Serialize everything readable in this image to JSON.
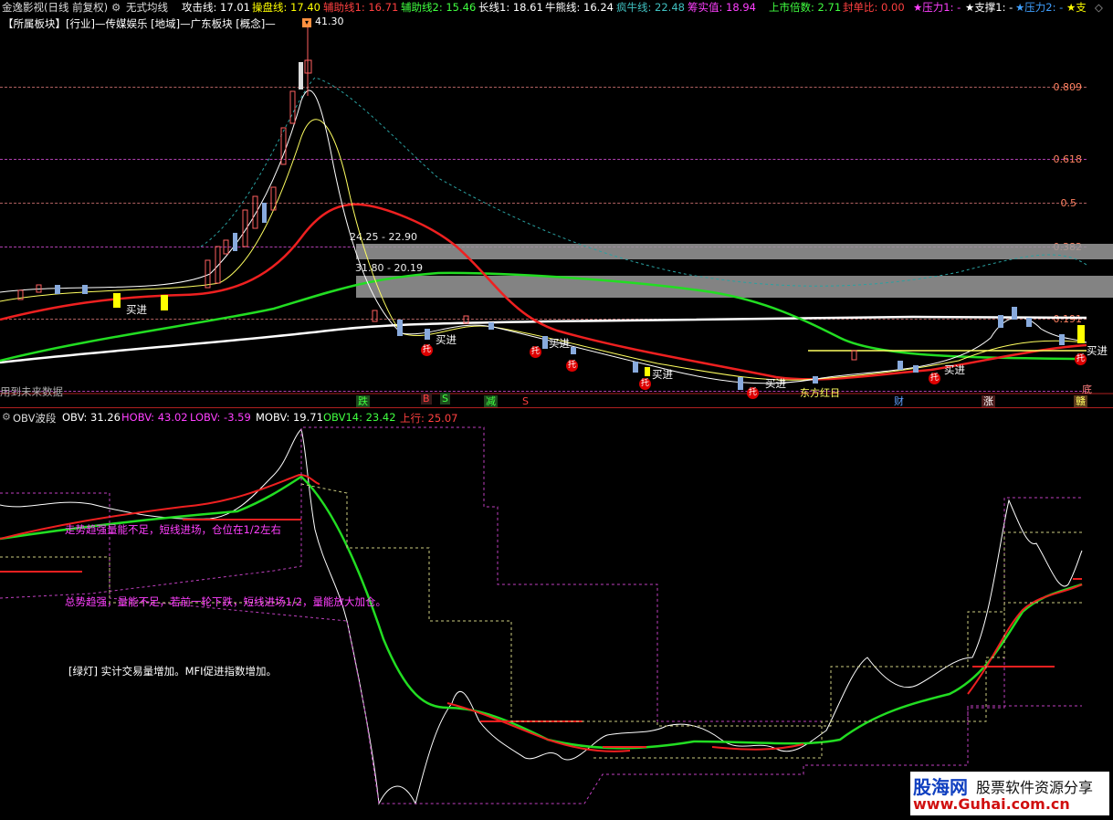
{
  "app": {
    "title": "金逸影视(日线 前复权)",
    "indicator_name": "无式均线"
  },
  "topbar": [
    {
      "text": "攻击线: 17.01",
      "color": "#ffffff"
    },
    {
      "text": "操盘线: 17.40",
      "color": "#ffff00"
    },
    {
      "text": "辅助线1: 16.71",
      "color": "#ff4040"
    },
    {
      "text": "辅助线2: 15.46",
      "color": "#40ff40"
    },
    {
      "text": "长线1: 18.61",
      "color": "#ffffff"
    },
    {
      "text": "牛熊线: 16.24",
      "color": "#ffffff"
    },
    {
      "text": "疯牛线: 22.48",
      "color": "#40c0c0"
    },
    {
      "text": "筹实值: 18.94",
      "color": "#ff40ff"
    },
    {
      "text": "上市倍数: 2.71",
      "color": "#40ff40"
    },
    {
      "text": "封单比: 0.00",
      "color": "#ff4040"
    },
    {
      "text": "★压力1: -",
      "color": "#ff40ff"
    },
    {
      "text": "★支撑1: -",
      "color": "#ffffff"
    },
    {
      "text": "★压力2: -",
      "color": "#40a0ff"
    },
    {
      "text": "★支",
      "color": "#ffff00"
    }
  ],
  "sector_line": "【所属板块】[行业]—传媒娱乐 [地域]—广东板块 [概念]—",
  "peak_price": "41.30",
  "fib_levels": [
    "0.809",
    "0.618",
    "0.5",
    "0.382",
    "0.191"
  ],
  "range_labels": [
    "24.25 - 22.90",
    "31.80 - 20.19"
  ],
  "future_text": "用到未来数据",
  "bottom_signals": [
    {
      "text": "跌",
      "color": "#40ff40",
      "bg": "#205020"
    },
    {
      "text": "B",
      "color": "#ff4040",
      "bg": "#402020"
    },
    {
      "text": "S",
      "color": "#40ff40",
      "bg": "#205020"
    },
    {
      "text": "减",
      "color": "#40ff40",
      "bg": "#205020"
    },
    {
      "text": "S",
      "color": "#ff4040",
      "bg": ""
    },
    {
      "text": "东方红日",
      "color": "#ffff60",
      "bg": ""
    },
    {
      "text": "财",
      "color": "#60a0ff",
      "bg": ""
    },
    {
      "text": "涨",
      "color": "#ffffff",
      "bg": "#502020"
    },
    {
      "text": "赣",
      "color": "#ffff60",
      "bg": "#604020"
    },
    {
      "text": "底",
      "color": "#ff8080",
      "bg": ""
    }
  ],
  "buy_label": "买进",
  "tuo_label": "托",
  "lower_panel": {
    "title": "OBV波段",
    "values": [
      {
        "text": "OBV: 31.26",
        "color": "#ffffff"
      },
      {
        "text": "HOBV: 43.02",
        "color": "#ff40ff"
      },
      {
        "text": "LOBV: -3.59",
        "color": "#ff40ff"
      },
      {
        "text": "MOBV: 19.71",
        "color": "#ffffff"
      },
      {
        "text": "OBV14: 23.42",
        "color": "#40ff40"
      },
      {
        "text": "上行: 25.07",
        "color": "#ff4040"
      }
    ],
    "notes": [
      {
        "text": "走势趋强量能不足，短线进场，仓位在1/2左右",
        "color": "#ff40ff"
      },
      {
        "text": "总势趋强，量能不足，若前一轮下跌，短线进场1/2，量能放大加仓。",
        "color": "#ff40ff"
      },
      {
        "text": "[绿灯] 实计交易量增加。MFI促进指数增加。",
        "color": "#ffffff"
      }
    ]
  },
  "watermark": {
    "brand": "股海网",
    "slogan": "股票软件资源分享",
    "url": "www.Guhai.com.cn"
  }
}
